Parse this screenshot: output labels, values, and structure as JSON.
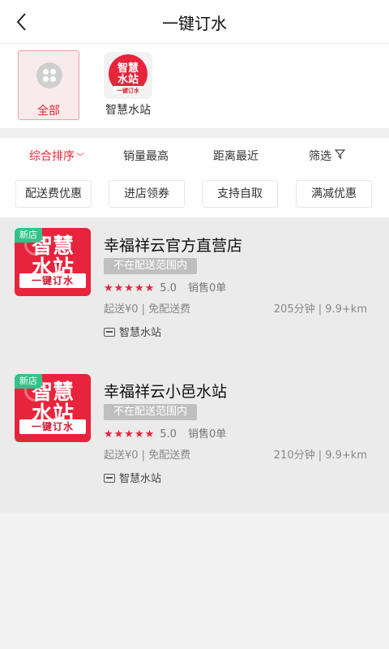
{
  "header": {
    "title": "一键订水"
  },
  "categories": [
    {
      "label": "全部",
      "active": true
    },
    {
      "label": "智慧水站",
      "active": false
    }
  ],
  "logo_text": {
    "line1": "智慧",
    "line2": "水站",
    "band": "一键订水"
  },
  "sort_tabs": [
    {
      "label": "综合排序",
      "active": true
    },
    {
      "label": "销量最高"
    },
    {
      "label": "距离最近"
    },
    {
      "label": "筛选"
    }
  ],
  "filter_chips": [
    "配送费优惠",
    "进店领券",
    "支持自取",
    "满减优惠"
  ],
  "shops": [
    {
      "tag": "新店",
      "name": "幸福祥云官方直营店",
      "range_status": "不在配送范围内",
      "rating": "5.0",
      "stars": 5,
      "sales": "销售0单",
      "fee": "起送¥0 | 免配送费",
      "distance": "205分钟 | 9.9+km",
      "brand": "智慧水站"
    },
    {
      "tag": "新店",
      "name": "幸福祥云小邑水站",
      "range_status": "不在配送范围内",
      "rating": "5.0",
      "stars": 5,
      "sales": "销售0单",
      "fee": "起送¥0 | 免配送费",
      "distance": "210分钟 | 9.9+km",
      "brand": "智慧水站"
    }
  ],
  "colors": {
    "accent": "#e02a3a",
    "brand_red": "#e8243d",
    "new_tag": "#33c28a"
  }
}
